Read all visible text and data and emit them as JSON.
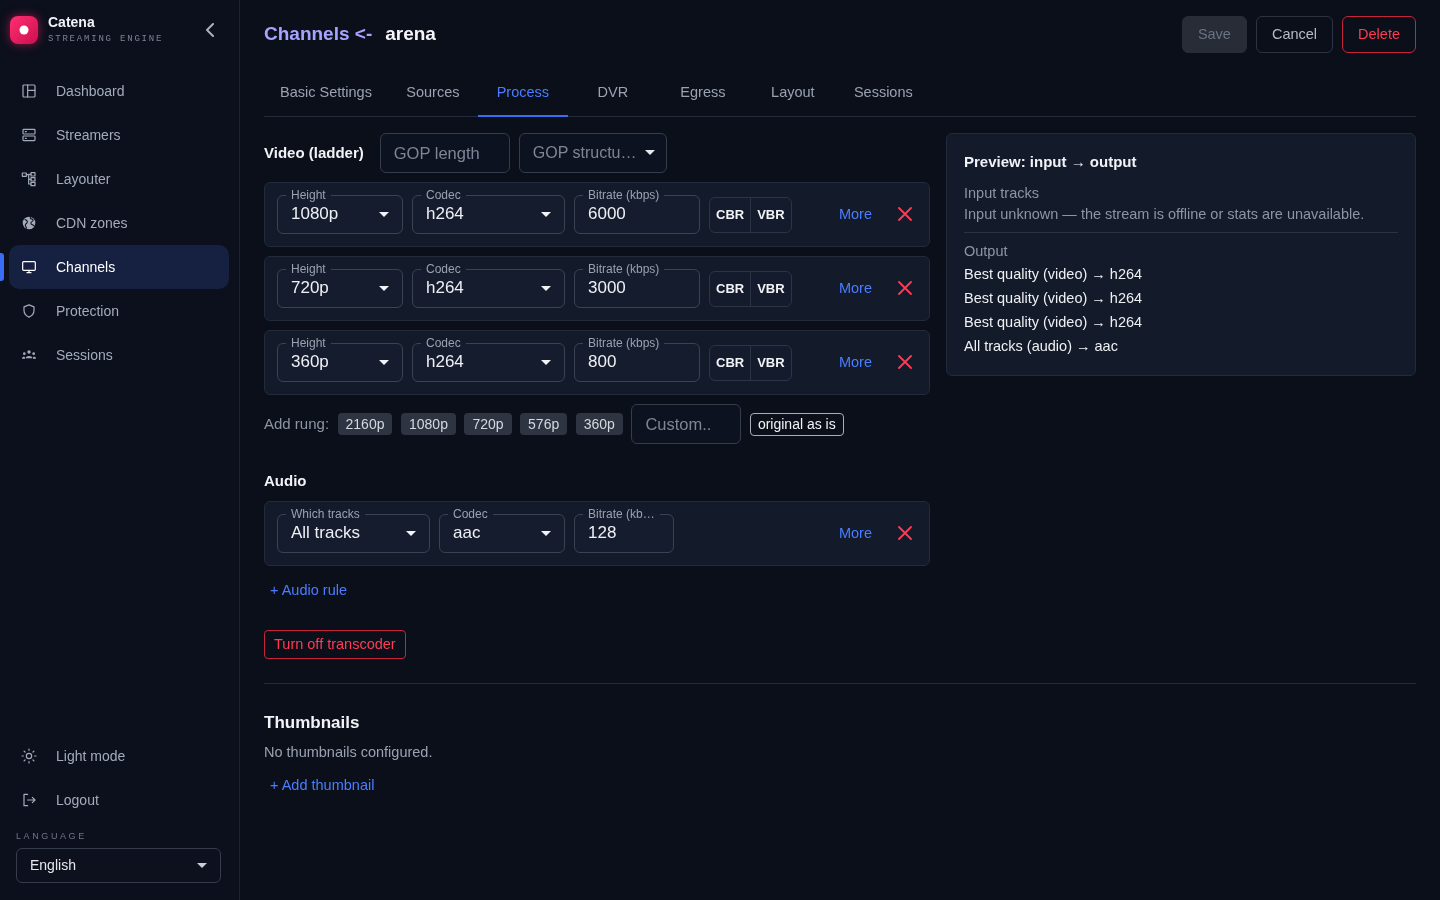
{
  "sidebar": {
    "brand": {
      "name": "Catena",
      "tagline": "STREAMING ENGINE"
    },
    "nav_items": [
      {
        "label": "Dashboard",
        "selected": false
      },
      {
        "label": "Streamers",
        "selected": false
      },
      {
        "label": "Layouter",
        "selected": false
      },
      {
        "label": "CDN zones",
        "selected": false
      },
      {
        "label": "Channels",
        "selected": true
      },
      {
        "label": "Protection",
        "selected": false
      },
      {
        "label": "Sessions",
        "selected": false
      }
    ],
    "footer_items": [
      {
        "label": "Light mode"
      },
      {
        "label": "Logout"
      }
    ],
    "language": {
      "label": "LANGUAGE",
      "value": "English"
    }
  },
  "header": {
    "breadcrumb": "Channels <-",
    "title": "arena",
    "buttons": [
      {
        "label": "Save",
        "kind": "save",
        "disabled": true
      },
      {
        "label": "Cancel",
        "kind": "cancel",
        "disabled": false
      },
      {
        "label": "Delete",
        "kind": "delete",
        "disabled": false
      }
    ]
  },
  "tabs": [
    {
      "label": "Basic Settings",
      "selected": false
    },
    {
      "label": "Sources",
      "selected": false
    },
    {
      "label": "Process",
      "selected": true
    },
    {
      "label": "DVR",
      "selected": false
    },
    {
      "label": "Egress",
      "selected": false
    },
    {
      "label": "Layout",
      "selected": false
    },
    {
      "label": "Sessions",
      "selected": false
    }
  ],
  "video": {
    "title": "Video (ladder)",
    "gop_length": {
      "placeholder": "GOP length"
    },
    "gop_structure": {
      "placeholder": "GOP structu…"
    },
    "rungs": [
      {
        "height": {
          "label": "Height",
          "value": "1080p"
        },
        "codec": {
          "label": "Codec",
          "value": "h264"
        },
        "bitrate": {
          "label": "Bitrate (kbps)",
          "value": "6000"
        },
        "modes": [
          {
            "label": "CBR",
            "selected": false
          },
          {
            "label": "VBR",
            "selected": false
          }
        ],
        "more": "More"
      },
      {
        "height": {
          "label": "Height",
          "value": "720p"
        },
        "codec": {
          "label": "Codec",
          "value": "h264"
        },
        "bitrate": {
          "label": "Bitrate (kbps)",
          "value": "3000"
        },
        "modes": [
          {
            "label": "CBR",
            "selected": false
          },
          {
            "label": "VBR",
            "selected": false
          }
        ],
        "more": "More"
      },
      {
        "height": {
          "label": "Height",
          "value": "360p"
        },
        "codec": {
          "label": "Codec",
          "value": "h264"
        },
        "bitrate": {
          "label": "Bitrate (kbps)",
          "value": "800"
        },
        "modes": [
          {
            "label": "CBR",
            "selected": false
          },
          {
            "label": "VBR",
            "selected": false
          }
        ],
        "more": "More"
      }
    ],
    "add_rung": {
      "label": "Add rung:",
      "presets": [
        "2160p",
        "1080p",
        "720p",
        "576p",
        "360p"
      ],
      "custom": {
        "placeholder": "Custom.."
      },
      "original": "original as is"
    }
  },
  "audio": {
    "title": "Audio",
    "rules": [
      {
        "tracks": {
          "label": "Which tracks",
          "value": "All tracks"
        },
        "codec": {
          "label": "Codec",
          "value": "aac"
        },
        "bitrate": {
          "label": "Bitrate (kb…",
          "value": "128"
        },
        "more": "More"
      }
    ],
    "add_rule": "+ Audio rule"
  },
  "transcoder_button": "Turn off transcoder",
  "thumbnails": {
    "title": "Thumbnails",
    "empty_text": "No thumbnails configured.",
    "add": "+ Add thumbnail"
  },
  "preview": {
    "title": "Preview: input → output",
    "input_heading": "Input tracks",
    "input_text": "Input unknown — the stream is offline or stats are unavailable.",
    "output_heading": "Output",
    "outputs": [
      "Best quality (video) → h264",
      "Best quality (video) → h264",
      "Best quality (video) → h264",
      "All tracks (audio) → aac"
    ]
  }
}
